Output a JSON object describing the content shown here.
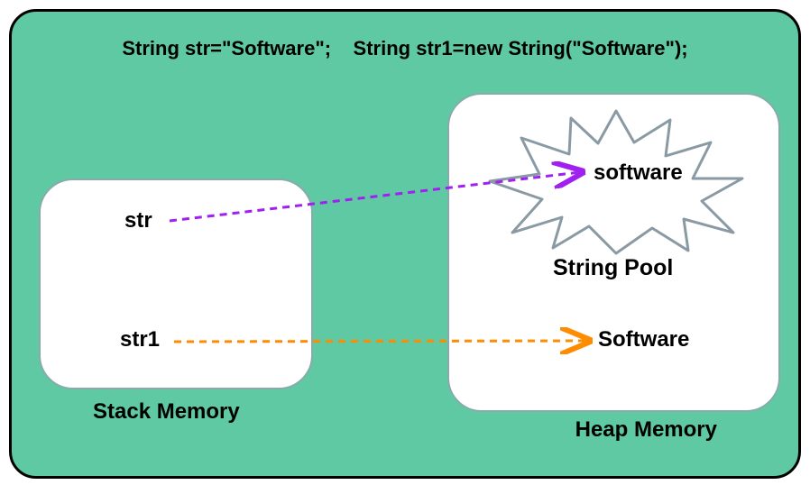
{
  "code": {
    "decl1": "String str=\"Software\";",
    "decl2": "String str1=new String(\"Software\");"
  },
  "stack": {
    "label": "Stack Memory",
    "var1": "str",
    "var2": "str1"
  },
  "heap": {
    "label": "Heap Memory",
    "pool_label": "String Pool",
    "pool_value": "software",
    "heap_value": "Software"
  },
  "arrows": [
    {
      "from": "str",
      "to": "pool_value",
      "color": "#a020f0"
    },
    {
      "from": "str1",
      "to": "heap_value",
      "color": "#ff8c00"
    }
  ]
}
